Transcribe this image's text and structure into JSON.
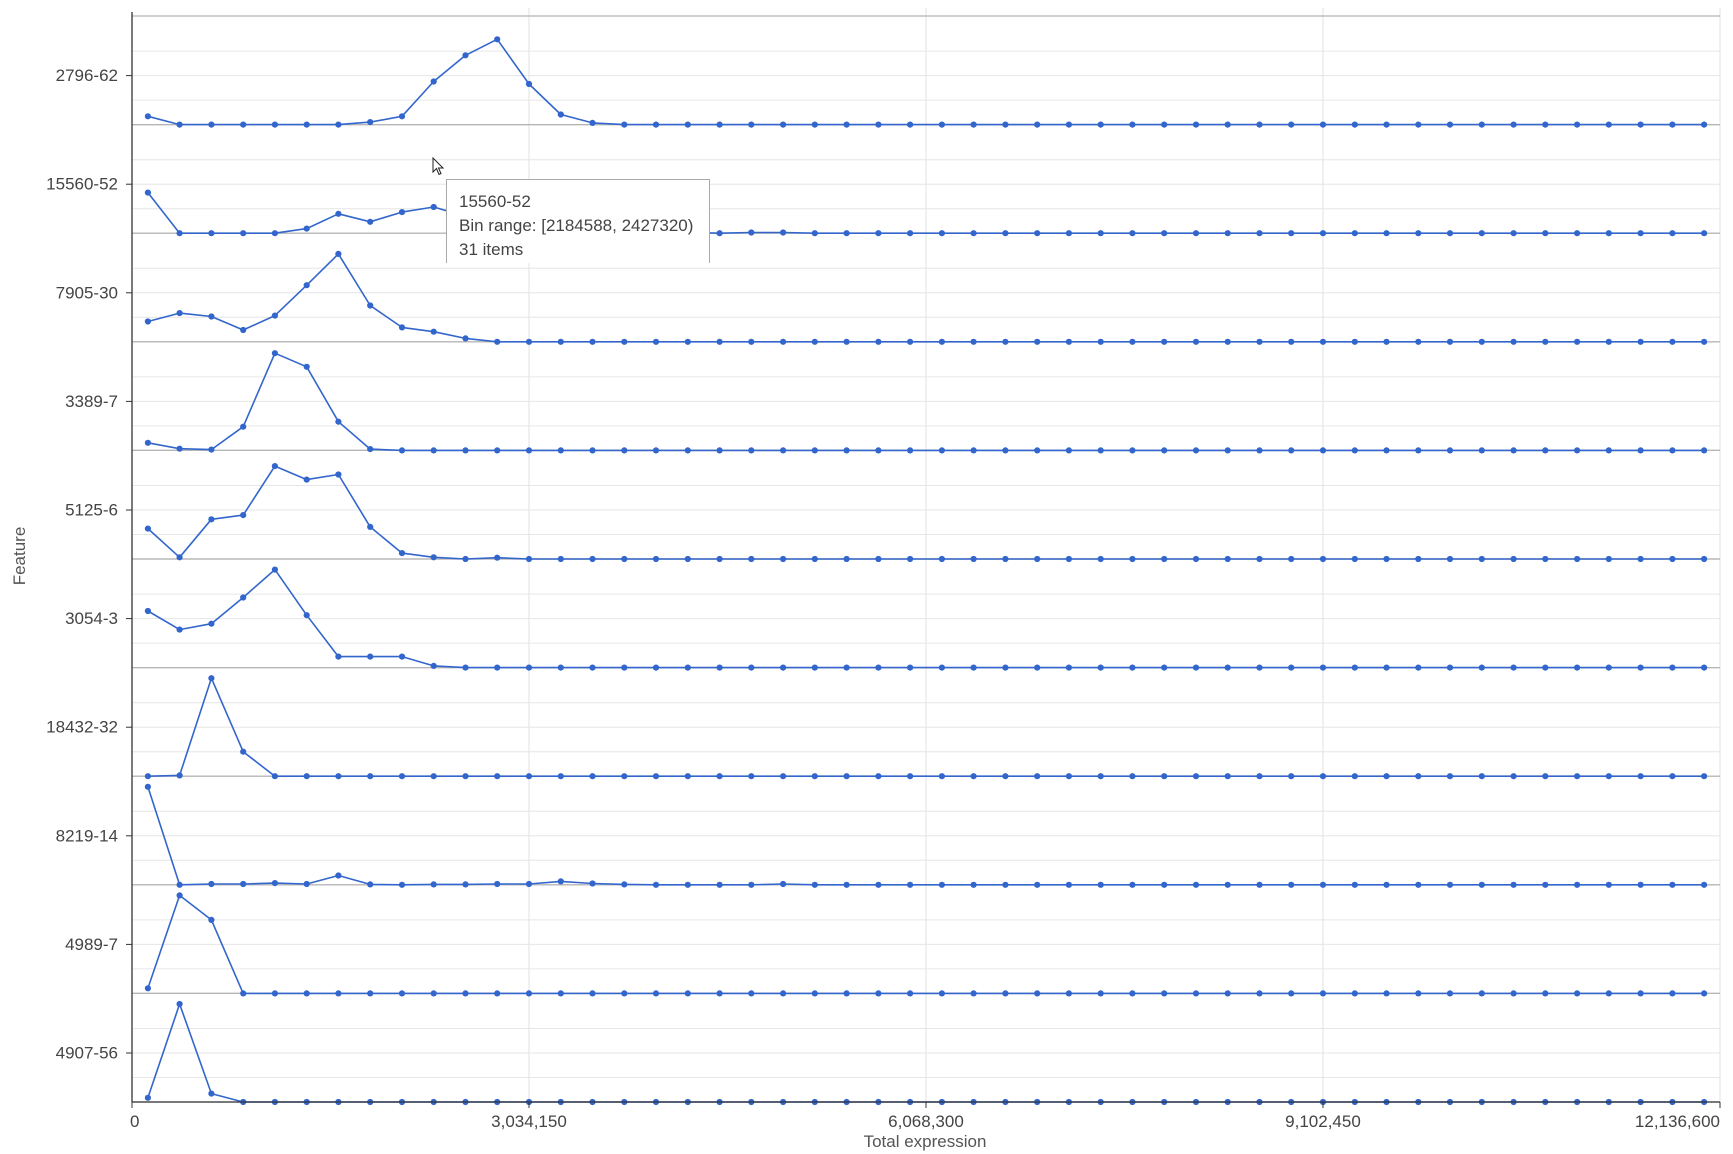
{
  "chart_data": {
    "type": "line",
    "xlabel": "Total expression",
    "ylabel": "Feature",
    "xlim": [
      0,
      12136600
    ],
    "x_ticks": [
      0,
      3034150,
      6068300,
      9102450,
      12136600
    ],
    "x_tick_labels": [
      "0",
      "3,034,150",
      "6,068,300",
      "9,102,450",
      "12,136,600"
    ],
    "grid": true,
    "line_color": "#3366cc",
    "bin_width": 242732,
    "bin_count": 50,
    "x_centers": [
      121366,
      364098,
      606830,
      849562,
      1092294,
      1335026,
      1577758,
      1820490,
      2063222,
      2305954,
      2548686,
      2791418,
      3034150,
      3276882,
      3519614,
      3762346,
      4005078,
      4247810,
      4490542,
      4733274,
      4976006,
      5218738,
      5461470,
      5704202,
      5946934,
      6189666,
      6432398,
      6675130,
      6917862,
      7160594,
      7403326,
      7646058,
      7888790,
      8131522,
      8374254,
      8616986,
      8859718,
      9102450,
      9345182,
      9587914,
      9830646,
      10073378,
      10316110,
      10558842,
      10801574,
      11044306,
      11287038,
      11529770,
      11772502,
      12015234
    ],
    "series": [
      {
        "name": "2796-62",
        "values": [
          9.8,
          0,
          0,
          0,
          0,
          0,
          0,
          3,
          9.8,
          51,
          82,
          101,
          48,
          12,
          2,
          0,
          0,
          0,
          0,
          0,
          0,
          0,
          0,
          0,
          0,
          0,
          0,
          0,
          0,
          0,
          0,
          0,
          0,
          0,
          0,
          0,
          0,
          0,
          0,
          0,
          0,
          0,
          0,
          0,
          0,
          0,
          0,
          0,
          0,
          0
        ]
      },
      {
        "name": "15560-52",
        "values": [
          48,
          0,
          0,
          0,
          0,
          5.5,
          23,
          13.5,
          25,
          31,
          20,
          7,
          3,
          1,
          1,
          1,
          1,
          1,
          0,
          0.8,
          0.8,
          0,
          0,
          0,
          0,
          0,
          0,
          0,
          0,
          0,
          0,
          0,
          0,
          0,
          0,
          0,
          0,
          0,
          0,
          0,
          0,
          0,
          0,
          0,
          0,
          0,
          0,
          0,
          0,
          0
        ]
      },
      {
        "name": "7905-30",
        "values": [
          24,
          34,
          30,
          14,
          31,
          67,
          104,
          43,
          17,
          12,
          4,
          0,
          0,
          0,
          0,
          0,
          0,
          0,
          0,
          0,
          0,
          0,
          0,
          0,
          0,
          0,
          0,
          0,
          0,
          0,
          0,
          0,
          0,
          0,
          0,
          0,
          0,
          0,
          0,
          0,
          0,
          0,
          0,
          0,
          0,
          0,
          0,
          0,
          0,
          0
        ]
      },
      {
        "name": "3389-7",
        "values": [
          9,
          2,
          1,
          28,
          115,
          99,
          34,
          1.5,
          0,
          0,
          0,
          0,
          0,
          0,
          0,
          0,
          0,
          0,
          0,
          0,
          0,
          0,
          0,
          0,
          0,
          0,
          0,
          0,
          0,
          0,
          0,
          0,
          0,
          0,
          0,
          0,
          0,
          0,
          0,
          0,
          0,
          0,
          0,
          0,
          0,
          0,
          0,
          0,
          0,
          0
        ]
      },
      {
        "name": "5125-6",
        "values": [
          36,
          2,
          47,
          52,
          110,
          94,
          100,
          38,
          7,
          2,
          0,
          1.5,
          0,
          0,
          0,
          0,
          0,
          0,
          0,
          0,
          0,
          0,
          0,
          0,
          0,
          0,
          0,
          0,
          0,
          0,
          0,
          0,
          0,
          0,
          0,
          0,
          0,
          0,
          0,
          0,
          0,
          0,
          0,
          0,
          0,
          0,
          0,
          0,
          0,
          0
        ]
      },
      {
        "name": "3054-3",
        "values": [
          67,
          45,
          52,
          83,
          116,
          62,
          13,
          13,
          13,
          2,
          0,
          0,
          0,
          0,
          0,
          0,
          0,
          0,
          0,
          0,
          0,
          0,
          0,
          0,
          0,
          0,
          0,
          0,
          0,
          0,
          0,
          0,
          0,
          0,
          0,
          0,
          0,
          0,
          0,
          0,
          0,
          0,
          0,
          0,
          0,
          0,
          0,
          0,
          0,
          0
        ]
      },
      {
        "name": "18432-32",
        "values": [
          0,
          1,
          116,
          29,
          0,
          0,
          0,
          0,
          0,
          0,
          0,
          0,
          0,
          0,
          0,
          0,
          0,
          0,
          0,
          0,
          0,
          0,
          0,
          0,
          0,
          0,
          0,
          0,
          0,
          0,
          0,
          0,
          0,
          0,
          0,
          0,
          0,
          0,
          0,
          0,
          0,
          0,
          0,
          0,
          0,
          0,
          0,
          0,
          0,
          0
        ]
      },
      {
        "name": "8219-14",
        "values": [
          116,
          0,
          1,
          1,
          2,
          1,
          11,
          0.5,
          0,
          0.5,
          0.5,
          1,
          1,
          4,
          1.5,
          0.5,
          0,
          0,
          0,
          0,
          1,
          0,
          0,
          0,
          0,
          0,
          0,
          0,
          0,
          0,
          0,
          0,
          0,
          0,
          0,
          0,
          0,
          0,
          0,
          0,
          0,
          0,
          0,
          0,
          0,
          0,
          0,
          0,
          0,
          0
        ]
      },
      {
        "name": "4989-7",
        "values": [
          6,
          116,
          87,
          0,
          0,
          0,
          0,
          0,
          0,
          0,
          0,
          0,
          0,
          0,
          0,
          0,
          0,
          0,
          0,
          0,
          0,
          0,
          0,
          0,
          0,
          0,
          0,
          0,
          0,
          0,
          0,
          0,
          0,
          0,
          0,
          0,
          0,
          0,
          0,
          0,
          0,
          0,
          0,
          0,
          0,
          0,
          0,
          0,
          0,
          0
        ]
      },
      {
        "name": "4907-56",
        "values": [
          5,
          116,
          10,
          0,
          0,
          0,
          0,
          0,
          0,
          0,
          0,
          0,
          0,
          0,
          0,
          0,
          0,
          0,
          0,
          0,
          0,
          0,
          0,
          0,
          0,
          0,
          0,
          0,
          0,
          0,
          0,
          0,
          0,
          0,
          0,
          0,
          0,
          0,
          0,
          0,
          0,
          0,
          0,
          0,
          0,
          0,
          0,
          0,
          0,
          0
        ]
      }
    ]
  },
  "tooltip": {
    "title": "15560-52",
    "bin_range": "Bin range: [2184588, 2427320)",
    "count": "31 items"
  },
  "cursor_icon": "arrow-cursor-icon"
}
